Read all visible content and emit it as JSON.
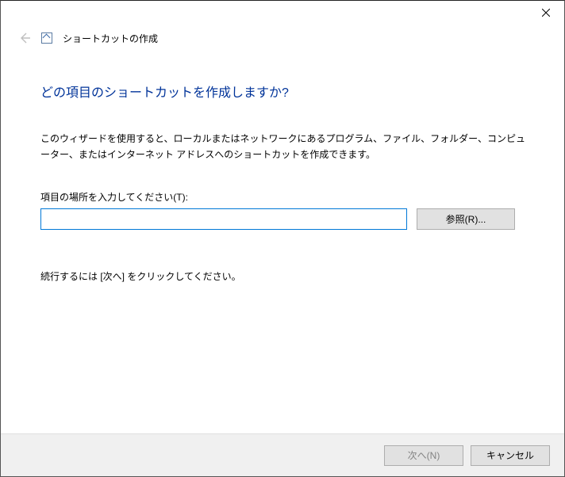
{
  "header": {
    "title": "ショートカットの作成"
  },
  "main": {
    "heading": "どの項目のショートカットを作成しますか?",
    "description": "このウィザードを使用すると、ローカルまたはネットワークにあるプログラム、ファイル、フォルダー、コンピューター、またはインターネット アドレスへのショートカットを作成できます。",
    "field_label": "項目の場所を入力してください(T):",
    "input_value": "",
    "browse_label": "参照(R)...",
    "continue_text": "続行するには [次へ] をクリックしてください。"
  },
  "footer": {
    "next_label": "次へ(N)",
    "cancel_label": "キャンセル"
  }
}
